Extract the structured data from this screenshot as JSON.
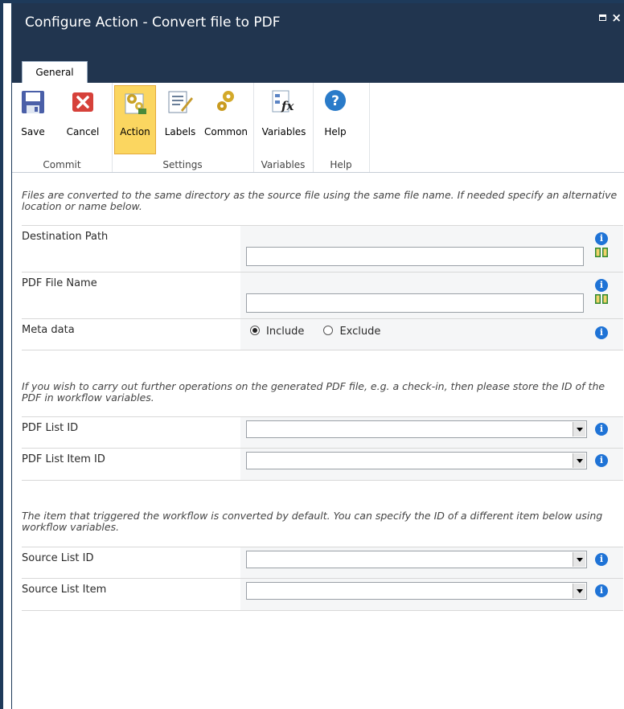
{
  "window": {
    "title": "Configure Action - Convert file to PDF"
  },
  "tabs": [
    {
      "label": "General"
    }
  ],
  "ribbon": {
    "groups": [
      {
        "label": "Commit"
      },
      {
        "label": "Settings"
      },
      {
        "label": "Variables"
      },
      {
        "label": "Help"
      }
    ],
    "buttons": {
      "save": "Save",
      "cancel": "Cancel",
      "action": "Action",
      "labels": "Labels",
      "common": "Common",
      "variables": "Variables",
      "help": "Help"
    }
  },
  "section1": {
    "intro": "Files are converted to the same directory as the source file using the same file name. If needed specify an alternative location or name below.",
    "fields": {
      "destination_path": {
        "label": "Destination Path",
        "value": ""
      },
      "pdf_file_name": {
        "label": "PDF File Name",
        "value": ""
      },
      "meta_data": {
        "label": "Meta data",
        "options": [
          "Include",
          "Exclude"
        ],
        "selected": "Include"
      }
    }
  },
  "section2": {
    "intro": "If you wish to carry out further operations on the generated PDF file, e.g. a check-in, then please store the ID of the PDF in workflow variables.",
    "fields": {
      "pdf_list_id": {
        "label": "PDF List ID",
        "value": ""
      },
      "pdf_list_item_id": {
        "label": "PDF List Item ID",
        "value": ""
      }
    }
  },
  "section3": {
    "intro": "The item that triggered the workflow is converted by default. You can specify the ID of a different item below using workflow variables.",
    "fields": {
      "source_list_id": {
        "label": "Source List ID",
        "value": ""
      },
      "source_list_item": {
        "label": "Source List Item",
        "value": ""
      }
    }
  },
  "icons": {
    "info": "i",
    "colors": {
      "info": "#1f73d6",
      "titlebar": "#21354f",
      "active_button": "#fbd660"
    }
  }
}
